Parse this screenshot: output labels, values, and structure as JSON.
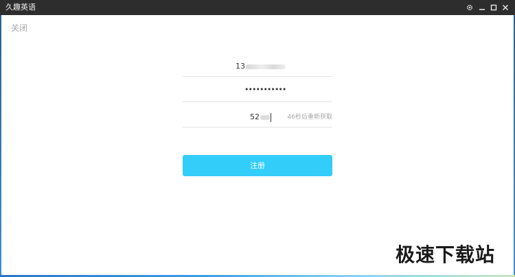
{
  "window": {
    "title": "久趣英语",
    "controls": {
      "settings_icon": "gear-icon",
      "minimize_icon": "minimize-icon",
      "maximize_icon": "maximize-icon",
      "close_icon": "close-icon"
    }
  },
  "header": {
    "close_label": "关闭"
  },
  "form": {
    "phone": {
      "value_visible": "13"
    },
    "password": {
      "masked_value": "●●●●●●●●●●●"
    },
    "code": {
      "value_visible": "52",
      "resend_label": "46秒后重新获取"
    }
  },
  "register_button": {
    "label": "注册",
    "color": "#33cdfa"
  },
  "watermark": {
    "text": "极速下载站"
  },
  "colors": {
    "titlebar": "#2d2d2d",
    "field_border": "#e4e4e4",
    "muted_text": "#a6a6a6"
  }
}
